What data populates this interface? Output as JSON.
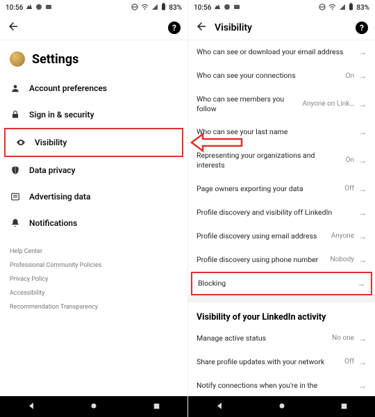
{
  "status": {
    "time": "10:56",
    "battery": "83%"
  },
  "help_glyph": "?",
  "left": {
    "title": "Settings",
    "nav": [
      {
        "icon": "person",
        "label": "Account preferences"
      },
      {
        "icon": "lock",
        "label": "Sign in & security"
      },
      {
        "icon": "eye",
        "label": "Visibility"
      },
      {
        "icon": "shield",
        "label": "Data privacy"
      },
      {
        "icon": "newspaper",
        "label": "Advertising data"
      },
      {
        "icon": "bell",
        "label": "Notifications"
      }
    ],
    "footer": [
      "Help Center",
      "Professional Community Policies",
      "Privacy Policy",
      "Accessibility",
      "Recommendation Transparency"
    ]
  },
  "right": {
    "title": "Visibility",
    "items": [
      {
        "label": "Who can see or download your email address",
        "value": ""
      },
      {
        "label": "Who can see your connections",
        "value": "On"
      },
      {
        "label": "Who can see members you follow",
        "value": "Anyone on Link…"
      },
      {
        "label": "Who can see your last name",
        "value": ""
      },
      {
        "label": "Representing your organizations and interests",
        "value": "On"
      },
      {
        "label": "Page owners exporting your data",
        "value": "Off"
      },
      {
        "label": "Profile discovery and visibility off LinkedIn",
        "value": ""
      },
      {
        "label": "Profile discovery using email address",
        "value": "Anyone"
      },
      {
        "label": "Profile discovery using phone number",
        "value": "Nobody"
      },
      {
        "label": "Blocking",
        "value": ""
      }
    ],
    "section2": "Visibility of your LinkedIn activity",
    "items2": [
      {
        "label": "Manage active status",
        "value": "No one"
      },
      {
        "label": "Share profile updates with your network",
        "value": "Off"
      },
      {
        "label": "Notify connections when you're in the",
        "value": ""
      }
    ]
  }
}
